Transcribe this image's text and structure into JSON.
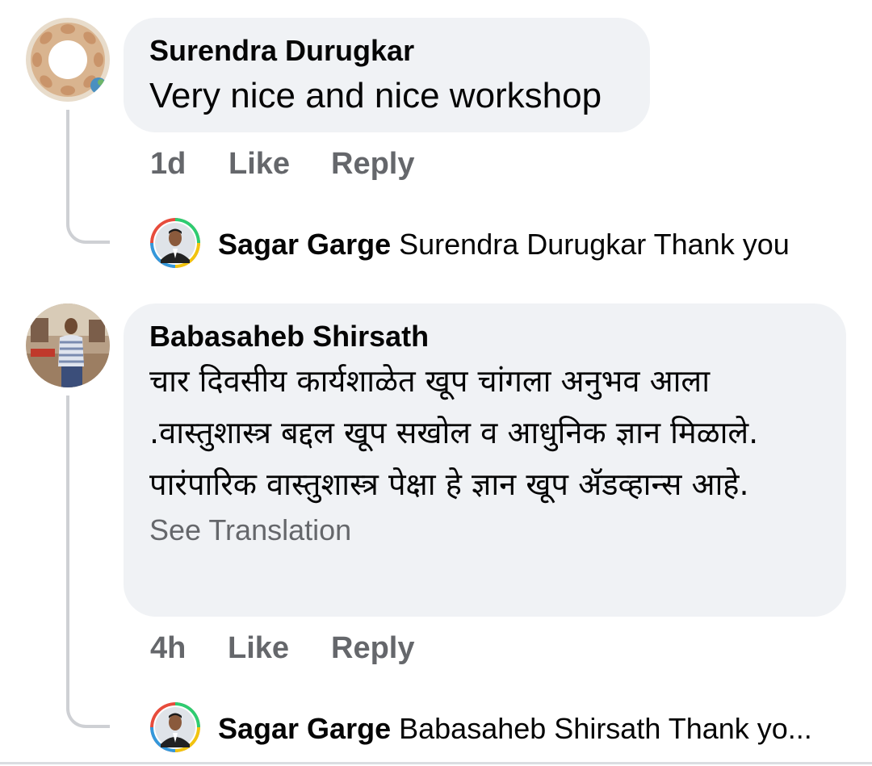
{
  "comments": [
    {
      "author": "Surendra Durugkar",
      "text": "Very nice and nice workshop",
      "time": "1d",
      "like_label": "Like",
      "reply_label": "Reply",
      "avatar_icon": "circle-of-hands-avatar",
      "reply": {
        "author": "Sagar Garge",
        "text": "Surendra Durugkar Thank you",
        "avatar_icon": "profile-photo-avatar"
      }
    },
    {
      "author": "Babasaheb Shirsath",
      "text": "चार दिवसीय कार्यशाळेत खूप चांगला अनुभव आला .वास्तुशास्त्र बद्दल खूप सखोल व आधुनिक ज्ञान मिळाले. पारंपारिक वास्तुशास्त्र पेक्षा हे ज्ञान खूप ॲडव्हान्स आहे.",
      "see_translation": "See Translation",
      "time": "4h",
      "like_label": "Like",
      "reply_label": "Reply",
      "avatar_icon": "profile-photo-avatar",
      "reply": {
        "author": "Sagar Garge",
        "text": "Babasaheb Shirsath Thank yo...",
        "avatar_icon": "profile-photo-avatar"
      }
    }
  ],
  "colors": {
    "bubble_bg": "#f0f2f5",
    "meta_text": "#65676b",
    "thread_line": "#ced0d4",
    "primary_text": "#050505"
  }
}
